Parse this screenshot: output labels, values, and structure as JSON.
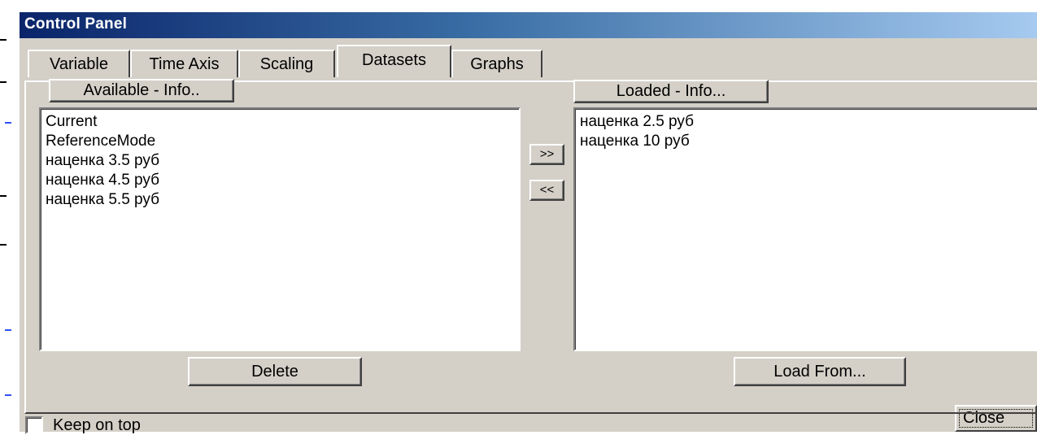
{
  "window": {
    "title": "Control Panel"
  },
  "tabs": [
    {
      "label": "Variable"
    },
    {
      "label": "Time Axis"
    },
    {
      "label": "Scaling"
    },
    {
      "label": "Datasets"
    },
    {
      "label": "Graphs"
    }
  ],
  "active_tab": "Datasets",
  "available": {
    "header": "Available - Info..",
    "items": [
      "Current",
      "ReferenceMode",
      "наценка 3.5 руб",
      "наценка 4.5 руб",
      "наценка 5.5 руб"
    ]
  },
  "loaded": {
    "header": "Loaded - Info...",
    "items": [
      "наценка 2.5 руб",
      "наценка 10 руб"
    ]
  },
  "buttons": {
    "move_right": ">>",
    "move_left": "<<",
    "delete": "Delete",
    "load_from": "Load From...",
    "close": "Close"
  },
  "keep_on_top": {
    "label": "Keep on top",
    "checked": false
  }
}
